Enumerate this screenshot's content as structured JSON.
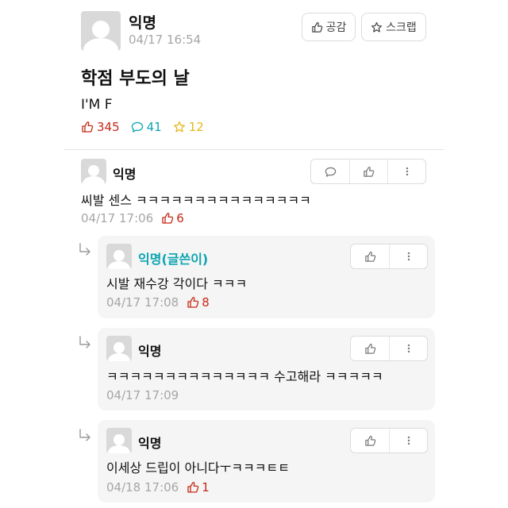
{
  "post": {
    "author": "익명",
    "time": "04/17 16:54",
    "like_label": "공감",
    "scrap_label": "스크랩",
    "title": "학점 부도의 날",
    "body": "I'M F",
    "stats": {
      "likes": "345",
      "comments": "41",
      "scraps": "12"
    }
  },
  "comments": [
    {
      "author": "익명",
      "body": "씨발 센스 ㅋㅋㅋㅋㅋㅋㅋㅋㅋㅋㅋㅋㅋㅋㅋ",
      "time": "04/17 17:06",
      "votes": "6"
    }
  ],
  "replies": [
    {
      "author": "익명(글쓴이)",
      "body": "시발 재수강 각이다 ㅋㅋㅋ",
      "time": "04/17 17:08",
      "votes": "8"
    },
    {
      "author": "익명",
      "body": "ㅋㅋㅋㅋㅋㅋㅋㅋㅋㅋㅋㅋㅋㅋ 수고해라 ㅋㅋㅋㅋㅋ",
      "time": "04/17 17:09",
      "votes": ""
    },
    {
      "author": "익명",
      "body": "이세상 드립이 아니다ㅜㅋㅋㅋㅌㅌ",
      "time": "04/18 17:06",
      "votes": "1"
    }
  ],
  "colors": {
    "vote": "#c62917",
    "comment": "#0ca5b0",
    "scrap": "#e6b71e",
    "op": "#0ca5b0"
  },
  "icons": [
    "thumbs-up-icon",
    "star-icon",
    "speech-bubble-icon",
    "more-vertical-icon",
    "reply-arrow-icon"
  ]
}
